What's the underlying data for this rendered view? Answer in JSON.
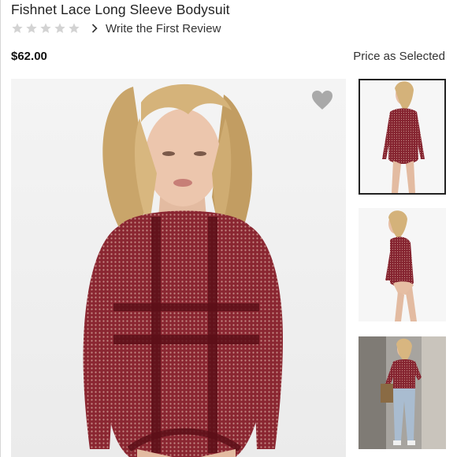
{
  "product": {
    "title": "Fishnet Lace Long Sleeve Bodysuit",
    "rating": {
      "stars_filled": 0,
      "stars_total": 5,
      "review_link_label": "Write the First Review"
    },
    "price": "$62.00",
    "price_note": "Price as Selected"
  },
  "icons": {
    "star": "star-icon",
    "chevron": "chevron-right-icon",
    "heart": "heart-icon"
  },
  "colors": {
    "garment": "#7a1a22",
    "star_empty": "#d3d3d3",
    "heart": "#a9a9a9",
    "selected_thumb_border": "#222222"
  },
  "gallery": {
    "selected_index": 0,
    "thumbnail_count": 3
  }
}
